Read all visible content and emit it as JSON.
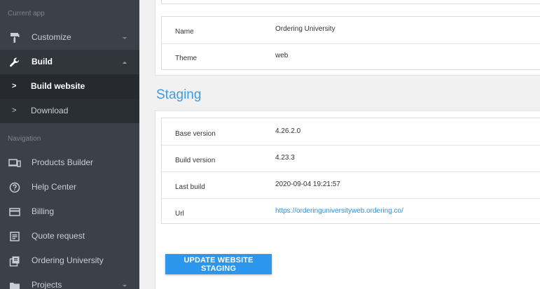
{
  "sidebar": {
    "current_app_label": "Current app",
    "navigation_label": "Navigation",
    "customize": "Customize",
    "build": "Build",
    "build_website": "Build website",
    "download": "Download",
    "products_builder": "Products Builder",
    "help_center": "Help Center",
    "billing": "Billing",
    "quote_request": "Quote request",
    "ordering_university": "Ordering University",
    "projects": "Projects",
    "sub_arrow": ">"
  },
  "info": {
    "name_label": "Name",
    "name_value": "Ordering University",
    "theme_label": "Theme",
    "theme_value": "web"
  },
  "staging": {
    "title": "Staging",
    "base_version_label": "Base version",
    "base_version_value": "4.26.2.0",
    "build_version_label": "Build version",
    "build_version_value": "4.23.3",
    "last_build_label": "Last build",
    "last_build_value": "2020-09-04 19:21:57",
    "url_label": "Url",
    "url_value": "https://orderinguniversityweb.ordering.co/",
    "button_label": "UPDATE WEBSITE STAGING"
  },
  "colors": {
    "sidebar_bg": "#3a4148",
    "accent": "#2b96ec",
    "link": "#2b8fd9"
  }
}
